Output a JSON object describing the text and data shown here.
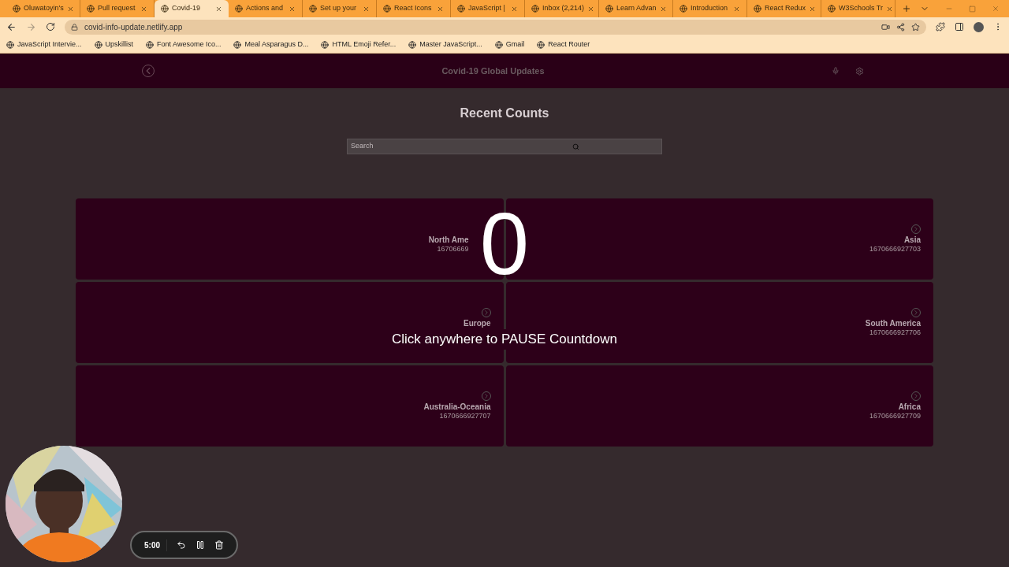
{
  "browser": {
    "tabs": [
      {
        "title": "Oluwatoyin's",
        "selected": false
      },
      {
        "title": "Pull request",
        "selected": false
      },
      {
        "title": "Covid-19",
        "selected": true
      },
      {
        "title": "Actions and",
        "selected": false
      },
      {
        "title": "Set up your",
        "selected": false
      },
      {
        "title": "React Icons",
        "selected": false
      },
      {
        "title": "JavaScript |",
        "selected": false
      },
      {
        "title": "Inbox (2,214)",
        "selected": false
      },
      {
        "title": "Learn Advan",
        "selected": false
      },
      {
        "title": "Introduction",
        "selected": false
      },
      {
        "title": "React Redux",
        "selected": false
      },
      {
        "title": "W3Schools Tr",
        "selected": false
      }
    ],
    "url": "covid-info-update.netlify.app",
    "bookmarks": [
      "JavaScript Intervie...",
      "Upskillist",
      "Font Awesome Ico...",
      "Meal Asparagus D...",
      "HTML Emoji Refer...",
      "Master JavaScript...",
      "Gmail",
      "React Router"
    ]
  },
  "app": {
    "title": "Covid-19 Global Updates",
    "heading": "Recent Counts",
    "search": {
      "placeholder": "Search"
    },
    "regions": [
      {
        "name": "North Ame",
        "number": "16706669"
      },
      {
        "name": "Asia",
        "number": "1670666927703"
      },
      {
        "name": "Europe"
      },
      {
        "name": "South America",
        "number": "1670666927706"
      },
      {
        "name": "Australia-Oceania",
        "number": "1670666927707"
      },
      {
        "name": "Africa",
        "number": "1670666927709"
      }
    ]
  },
  "overlay": {
    "count": "0",
    "message": "Click anywhere to PAUSE Countdown"
  },
  "recorder": {
    "time": "5:00"
  }
}
